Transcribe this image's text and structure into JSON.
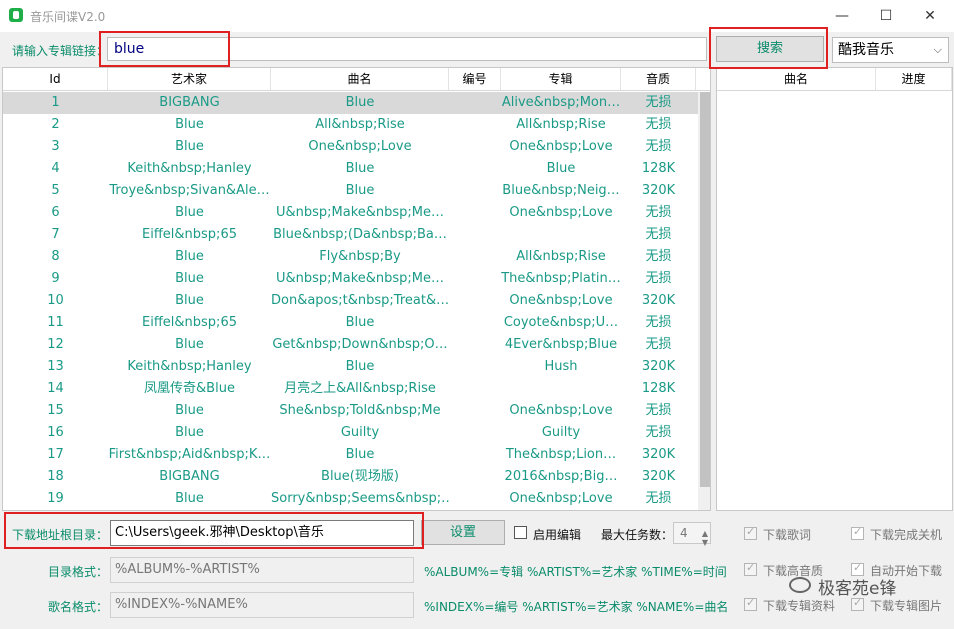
{
  "window": {
    "title": "音乐间谍V2.0"
  },
  "search": {
    "label": "请输入专辑链接：",
    "value": "blue",
    "button": "搜索",
    "source": "酷我音乐"
  },
  "table": {
    "columns": [
      "Id",
      "艺术家",
      "曲名",
      "编号",
      "专辑",
      "音质"
    ],
    "rows": [
      [
        "1",
        "BIGBANG",
        "Blue",
        "",
        "Alive&nbsp;Mon…",
        "无损"
      ],
      [
        "2",
        "Blue",
        "All&nbsp;Rise",
        "",
        "All&nbsp;Rise",
        "无损"
      ],
      [
        "3",
        "Blue",
        "One&nbsp;Love",
        "",
        "One&nbsp;Love",
        "无损"
      ],
      [
        "4",
        "Keith&nbsp;Hanley",
        "Blue",
        "",
        "Blue",
        "128K"
      ],
      [
        "5",
        "Troye&nbsp;Sivan&Ale…",
        "Blue",
        "",
        "Blue&nbsp;Neig…",
        "320K"
      ],
      [
        "6",
        "Blue",
        "U&nbsp;Make&nbsp;Me…",
        "",
        "One&nbsp;Love",
        "无损"
      ],
      [
        "7",
        "Eiffel&nbsp;65",
        "Blue&nbsp;(Da&nbsp;Ba…",
        "",
        "",
        "无损"
      ],
      [
        "8",
        "Blue",
        "Fly&nbsp;By",
        "",
        "All&nbsp;Rise",
        "无损"
      ],
      [
        "9",
        "Blue",
        "U&nbsp;Make&nbsp;Me…",
        "",
        "The&nbsp;Platin…",
        "无损"
      ],
      [
        "10",
        "Blue",
        "Don&apos;t&nbsp;Treat&…",
        "",
        "One&nbsp;Love",
        "320K"
      ],
      [
        "11",
        "Eiffel&nbsp;65",
        "Blue",
        "",
        "Coyote&nbsp;U…",
        "无损"
      ],
      [
        "12",
        "Blue",
        "Get&nbsp;Down&nbsp;O…",
        "",
        "4Ever&nbsp;Blue",
        "无损"
      ],
      [
        "13",
        "Keith&nbsp;Hanley",
        "Blue",
        "",
        "Hush",
        "320K"
      ],
      [
        "14",
        "凤凰传奇&Blue",
        "月亮之上&All&nbsp;Rise",
        "",
        "",
        "128K"
      ],
      [
        "15",
        "Blue",
        "She&nbsp;Told&nbsp;Me",
        "",
        "One&nbsp;Love",
        "无损"
      ],
      [
        "16",
        "Blue",
        "Guilty",
        "",
        "Guilty",
        "无损"
      ],
      [
        "17",
        "First&nbsp;Aid&nbsp;K…",
        "Blue",
        "",
        "The&nbsp;Lion…",
        "320K"
      ],
      [
        "18",
        "BIGBANG",
        "Blue(现场版)",
        "",
        "2016&nbsp;Big…",
        "320K"
      ],
      [
        "19",
        "Blue",
        "Sorry&nbsp;Seems&nbsp;…",
        "",
        "One&nbsp;Love",
        "无损"
      ]
    ]
  },
  "queue": {
    "columns": [
      "曲名",
      "进度"
    ]
  },
  "download": {
    "dir_label": "下载地址根目录：",
    "dir_value": "C:\\Users\\geek.邪神\\Desktop\\音乐",
    "setting_button": "设置",
    "enable_edit": "启用编辑",
    "max_tasks_label": "最大任务数：",
    "max_tasks_value": "4",
    "dir_format_label": "目录格式：",
    "dir_format_value": "%ALBUM%-%ARTIST%",
    "dir_format_hint": "%ALBUM%=专辑 %ARTIST%=艺术家 %TIME%=时间",
    "name_format_label": "歌名格式：",
    "name_format_value": "%INDEX%-%NAME%",
    "name_format_hint": "%INDEX%=编号 %ARTIST%=艺术家 %NAME%=曲名",
    "options": {
      "lyrics": "下载歌词",
      "shutdown": "下载完成关机",
      "hq": "下载高音质",
      "auto_start": "自动开始下载",
      "album_info": "下载专辑资料",
      "album_cover": "下载专辑图片"
    }
  },
  "watermark": "极客苑e锋",
  "colors": {
    "accent": "#0a8c6a",
    "row_text": "#1a9a86",
    "highlight": "#e02020"
  }
}
